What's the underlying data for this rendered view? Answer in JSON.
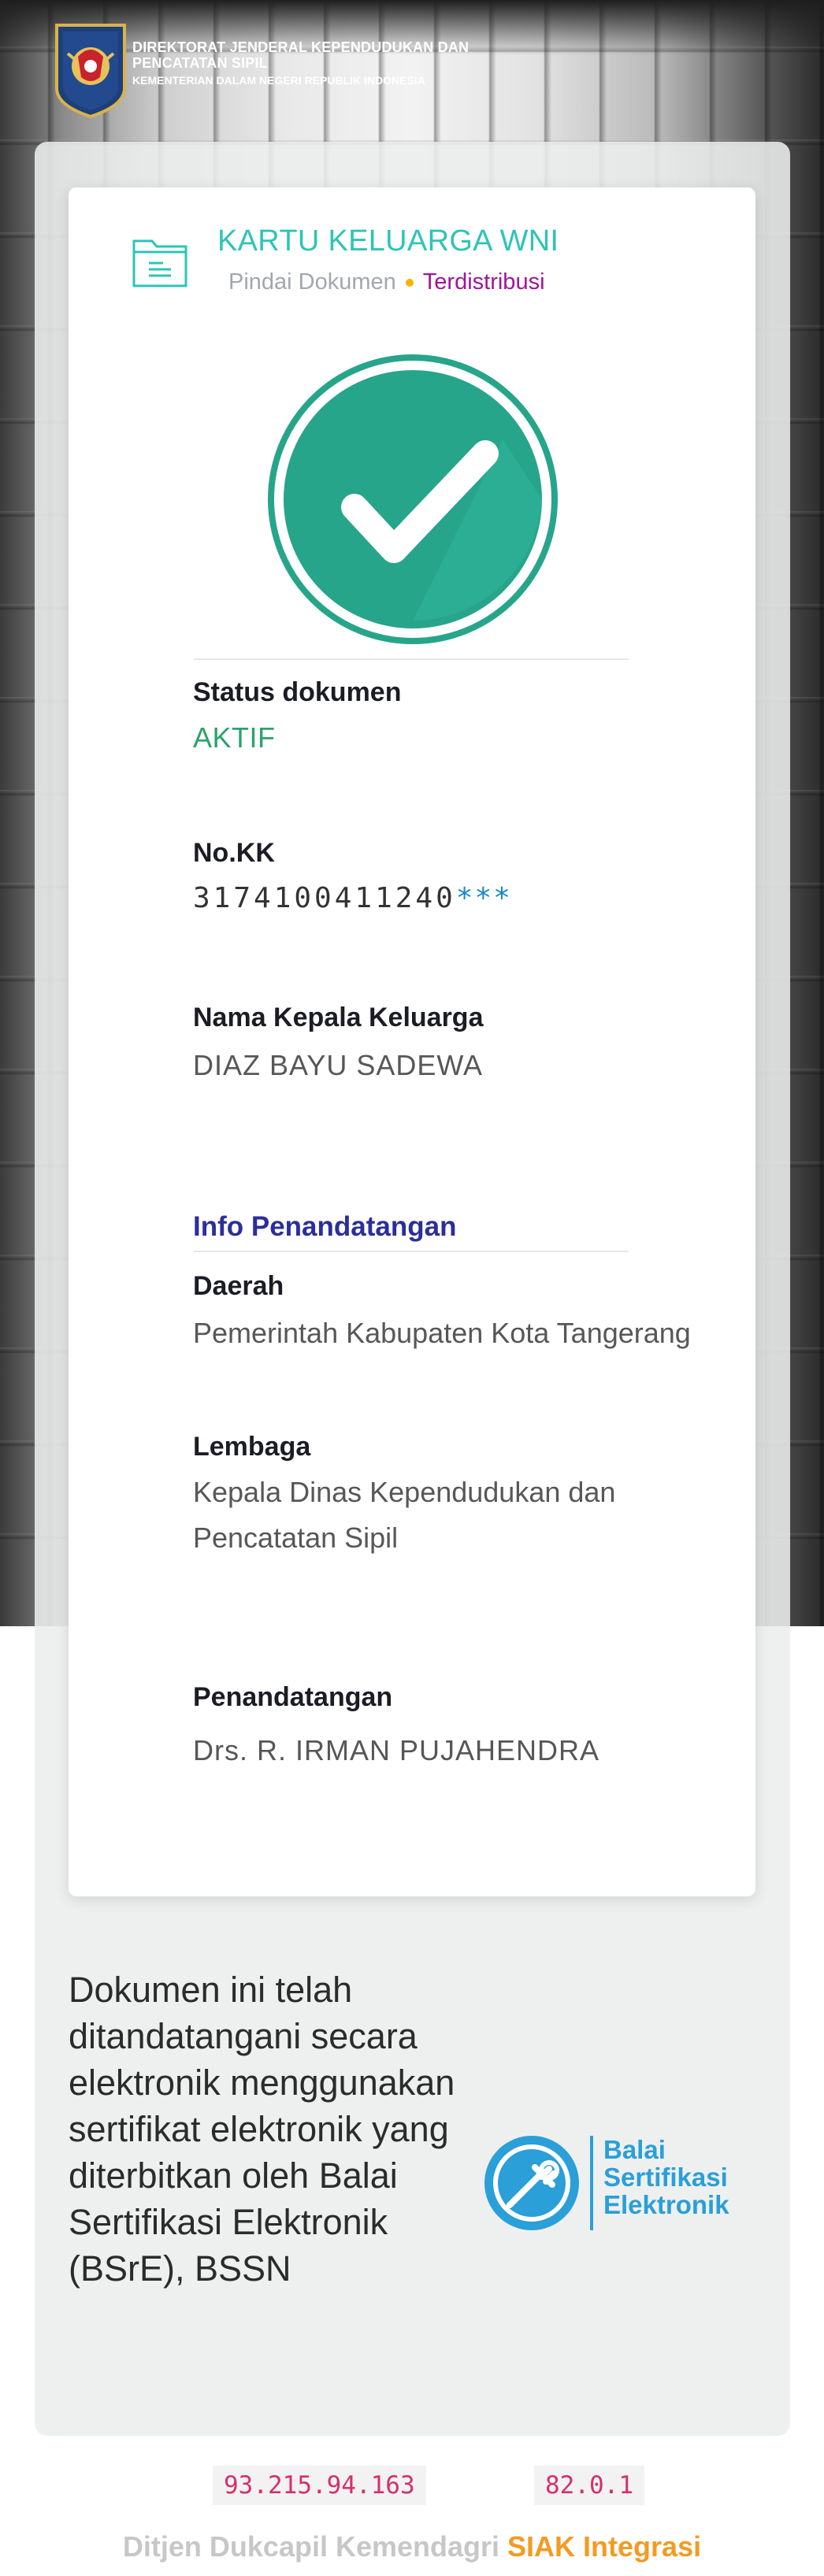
{
  "header": {
    "org_line1": "DIREKTORAT JENDERAL KEPENDUDUKAN DAN",
    "org_line2": "PENCATATAN SIPIL",
    "ministry": "KEMENTERIAN DALAM NEGERI REPUBLIK INDONESIA"
  },
  "document": {
    "title": "KARTU KELUARGA WNI",
    "scan_label": "Pindai Dokumen",
    "distribution_label": "Terdistribusi",
    "icon": "document-icon",
    "status_icon": "check-icon"
  },
  "fields": {
    "status_label": "Status dokumen",
    "status_value": "AKTIF",
    "kk_label": "No.KK",
    "kk_number": "3174100411240",
    "kk_mask": "***",
    "head_label": "Nama Kepala Keluarga",
    "head_value": "DIAZ BAYU SADEWA"
  },
  "signing": {
    "section_title": "Info Penandatangan",
    "region_label": "Daerah",
    "region_value": "Pemerintah Kabupaten Kota Tangerang",
    "agency_label": "Lembaga",
    "agency_value_line1": "Kepala Dinas Kependudukan dan",
    "agency_value_line2": "Pencatatan Sipil",
    "signer_label": "Penandatangan",
    "signer_value": "Drs. R. IRMAN PUJAHENDRA"
  },
  "esign": {
    "statement": "Dokumen ini telah ditandatangani secara elektronik menggunakan sertifikat elektronik yang diterbitkan oleh Balai Sertifikasi Elektronik (BSrE), BSSN",
    "logo_line1": "Balai",
    "logo_line2": "Sertifikasi",
    "logo_line3": "Elektronik"
  },
  "footer": {
    "ip": "93.215.94.163",
    "version": "82.0.1",
    "agency": "Ditjen Dukcapil Kemendagri",
    "system": "SIAK Integrasi"
  },
  "colors": {
    "accent_teal": "#2ec4b6",
    "active_green": "#2aa36b",
    "distribution_purple": "#a01597",
    "section_blue": "#2b2e9b",
    "footer_orange": "#f39b22",
    "bsre_blue": "#2a9fd8"
  }
}
